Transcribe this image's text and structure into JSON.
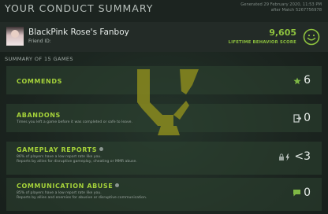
{
  "header": {
    "title": "YOUR CONDUCT SUMMARY",
    "generated": "Generated 29 February 2020, 11:53 PM",
    "after_match": "after Match 5267756978"
  },
  "profile": {
    "name": "BlackPink Rose's Fanboy",
    "friend_id": "Friend ID:",
    "score": "9,605",
    "score_label": "LIFETIME BEHAVIOR SCORE",
    "score_icon": "smiley-face-icon"
  },
  "summary": {
    "label": "SUMMARY OF 15 GAMES"
  },
  "rows": [
    {
      "label": "COMMENDS",
      "sub1": "",
      "sub2": "",
      "value": "6",
      "icon": "star-plus-icon"
    },
    {
      "label": "ABANDONS",
      "sub1": "Times you left a game before it was completed or safe to leave.",
      "sub2": "",
      "value": "0",
      "icon": "exit-door-icon"
    },
    {
      "label": "GAMEPLAY REPORTS",
      "sub1": "86% of players have a low report rate like you.",
      "sub2": "Reports by allies for disruptive gameplay, cheating or MMR abuse.",
      "value": "<3",
      "icon": "lock-bolt-icon"
    },
    {
      "label": "COMMUNICATION ABUSE",
      "sub1": "85% of players have a low report rate like you.",
      "sub2": "Reports by allies and enemies for abusive or disruptive communication.",
      "value": "0",
      "icon": "chat-bubble-icon"
    }
  ],
  "colors": {
    "accent": "#a5d23a",
    "score": "#8ec23e",
    "watermark": "#8a8a1e"
  }
}
